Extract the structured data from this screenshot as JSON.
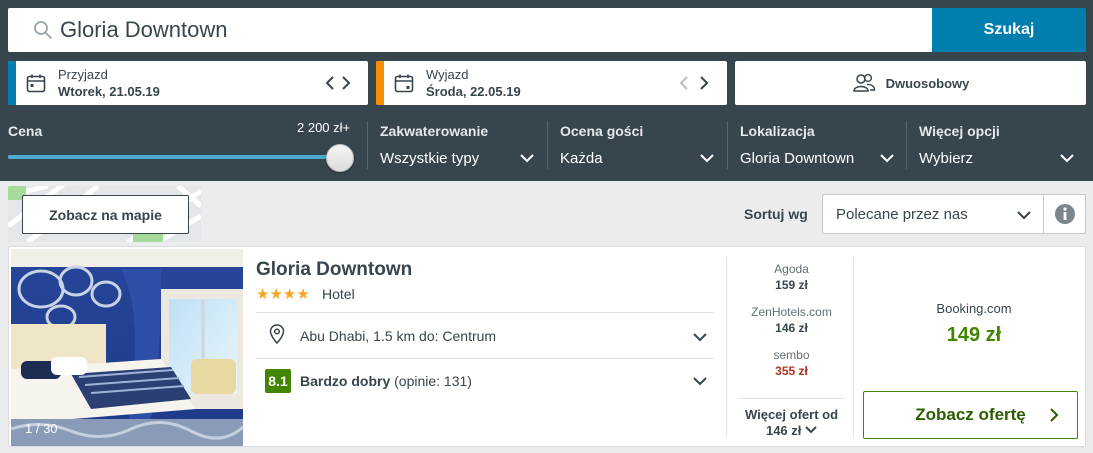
{
  "search": {
    "query": "Gloria Downtown",
    "button_label": "Szukaj"
  },
  "checkin": {
    "label": "Przyjazd",
    "value": "Wtorek, 21.05.19",
    "accent": "#007faf"
  },
  "checkout": {
    "label": "Wyjazd",
    "value": "Środa, 22.05.19",
    "accent": "#f48f00"
  },
  "room": {
    "label": "Dwuosobowy"
  },
  "filters": {
    "price": {
      "label": "Cena",
      "max_value": "2 200 zł+",
      "slider_fraction": 1.0
    },
    "accommodation": {
      "label": "Zakwaterowanie",
      "value": "Wszystkie typy"
    },
    "guest_rating": {
      "label": "Ocena gości",
      "value": "Każda"
    },
    "location": {
      "label": "Lokalizacja",
      "value": "Gloria Downtown"
    },
    "more": {
      "label": "Więcej opcji",
      "value": "Wybierz"
    }
  },
  "map": {
    "button_label": "Zobacz na mapie"
  },
  "sort": {
    "label": "Sortuj wg",
    "value": "Polecane przez nas"
  },
  "hotel": {
    "name": "Gloria Downtown",
    "stars": "★★★★",
    "type": "Hotel",
    "photo_count": "1 / 30",
    "location": "Abu Dhabi, 1.5 km do: Centrum",
    "rating_score": "8.1",
    "rating_label": "Bardzo dobry",
    "rating_reviews": "(opinie: 131)",
    "offers": [
      {
        "site": "Agoda",
        "price": "159 zł"
      },
      {
        "site": "ZenHotels.com",
        "price": "146 zł"
      },
      {
        "site": "sembo",
        "price": "355 zł"
      }
    ],
    "more_offers_line1": "Więcej ofert od",
    "more_offers_line2": "146 zł",
    "best_site": "Booking.com",
    "best_price": "149 zł",
    "deal_button_label": "Zobacz ofertę"
  },
  "colors": {
    "header_bg": "#37454d",
    "primary": "#007faf",
    "rating_green": "#428500",
    "price_red": "#b0321f"
  }
}
